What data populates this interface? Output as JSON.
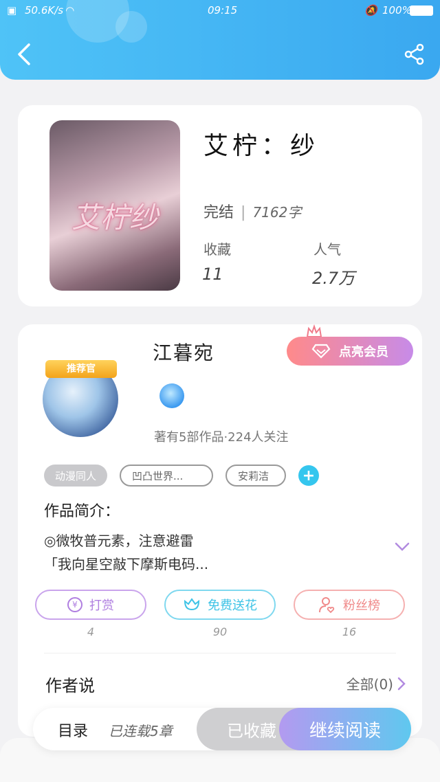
{
  "status_bar": {
    "speed": "50.6K/s",
    "time": "09:15",
    "battery": "100%"
  },
  "header": {
    "back_icon": "chevron-left-icon",
    "share_icon": "share-icon"
  },
  "book": {
    "cover_text": "艾柠纱",
    "title": "艾柠：纱",
    "status": "完结",
    "word_count": "7162字",
    "collect_label": "收藏",
    "collect_value": "11",
    "popularity_label": "人气",
    "popularity_value": "2.7万"
  },
  "author": {
    "badge": "推荐官",
    "name": "江暮宛",
    "vip_label": "点亮会员",
    "stats": "著有5部作品·224人关注",
    "tags": [
      "动漫同人",
      "凹凸世界...",
      "安莉洁"
    ],
    "intro_heading": "作品简介：",
    "intro_line1": "◎微牧普元素，注意避雷",
    "intro_line2": "「我向星空敲下摩斯电码...",
    "actions": [
      {
        "label": "打赏",
        "count": "4",
        "color": "#b07fe0"
      },
      {
        "label": "免费送花",
        "count": "90",
        "color": "#3ec3e6"
      },
      {
        "label": "粉丝榜",
        "count": "16",
        "color": "#f08a8a"
      }
    ],
    "author_say": "作者说",
    "all_label": "全部(0)"
  },
  "bottom": {
    "toc": "目录",
    "chapters": "已连载5章",
    "collected": "已收藏",
    "read": "继续阅读"
  }
}
